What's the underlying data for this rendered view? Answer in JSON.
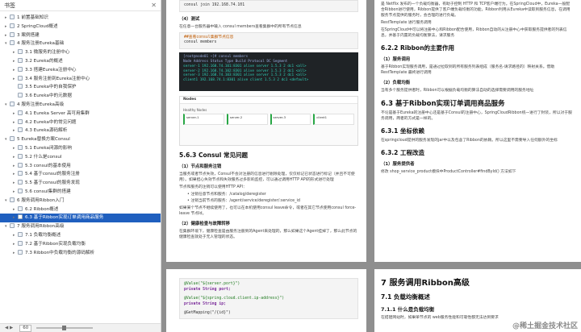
{
  "sidebar": {
    "title": "书签",
    "close_icon": "close-icon",
    "items": [
      {
        "label": "1 前置基础知识",
        "level": 1,
        "arrow": "▸"
      },
      {
        "label": "2 SpringCloud概述",
        "level": 1,
        "arrow": "▸"
      },
      {
        "label": "3 案例搭建",
        "level": 1,
        "arrow": "▸"
      },
      {
        "label": "4 服务注册Eureka基础",
        "level": 1,
        "arrow": "▾"
      },
      {
        "label": "3.1 微服务的注册中心",
        "level": 2,
        "arrow": "▸"
      },
      {
        "label": "3.2 Eureka的概述",
        "level": 2,
        "arrow": "▸"
      },
      {
        "label": "3.3 搭建Eureka注册中心",
        "level": 2,
        "arrow": "▸"
      },
      {
        "label": "3.4 服务注册到Eureka注册中心",
        "level": 2,
        "arrow": "▸"
      },
      {
        "label": "3.5 Eureka中的自我保护",
        "level": 2,
        "arrow": ""
      },
      {
        "label": "3.6 Eureka中的元数据",
        "level": 2,
        "arrow": ""
      },
      {
        "label": "4 服务注册Eureka高级",
        "level": 1,
        "arrow": "▾"
      },
      {
        "label": "4.1 Eureka Server 高可用集群",
        "level": 2,
        "arrow": "▸"
      },
      {
        "label": "4.2 Eureka中的常见问题",
        "level": 2,
        "arrow": "▸"
      },
      {
        "label": "4.3 Eureka源码解析",
        "level": 2,
        "arrow": "▸"
      },
      {
        "label": "5 Eureka替换方案Consul",
        "level": 1,
        "arrow": "▾"
      },
      {
        "label": "5.1 Eureka闭源的影响",
        "level": 2,
        "arrow": "▸"
      },
      {
        "label": "5.2 什么是consul",
        "level": 2,
        "arrow": "▸"
      },
      {
        "label": "5.3 consul的基本使用",
        "level": 2,
        "arrow": "▸"
      },
      {
        "label": "5.4 基于consul的服务注册",
        "level": 2,
        "arrow": "▸"
      },
      {
        "label": "5.5 基于consul的服务发现",
        "level": 2,
        "arrow": "▸"
      },
      {
        "label": "5.6 consul集群的搭建",
        "level": 2,
        "arrow": "▸"
      },
      {
        "label": "6 服务调用Ribbon入门",
        "level": 1,
        "arrow": "▾"
      },
      {
        "label": "6.2 Ribbon概述",
        "level": 2,
        "arrow": "▸"
      },
      {
        "label": "6.3 基于Ribbon实现订单调用商品服务",
        "level": 2,
        "arrow": "▸",
        "active": true
      },
      {
        "label": "7 服务调用Ribbon高级",
        "level": 1,
        "arrow": "▾"
      },
      {
        "label": "7.1 负载均衡概述",
        "level": 2,
        "arrow": "▸"
      },
      {
        "label": "7.2 基于Ribbon实现负载均衡",
        "level": 2,
        "arrow": "▸"
      },
      {
        "label": "7.3 Ribbon中负载均衡的源码解析",
        "level": 2,
        "arrow": "▸"
      }
    ],
    "footer": {
      "zoom": "60",
      "nav": "◀ ▶"
    }
  },
  "page1": {
    "code_top": "consul join 192.168.74.101",
    "h_test": "（4）测试",
    "p_test": "在任意一台服务器中输入 consul members查看集群中的所有节点信息",
    "code2_comment": "##查看consul集群节点信息",
    "code2_cmd": "consul members",
    "term_header": "[root@node01 ~]# consul members",
    "term_cols": "Node      Address              Status  Type    Build  Protocol  DC    Segment",
    "term_rows": [
      "server-1  192.168.74.101:8301  alive   server  1.5.3  2         dc1   <all>",
      "server-2  192.168.74.102:8301  alive   server  1.5.3  2         dc1   <all>",
      "server-3  192.168.74.103:8301  alive   server  1.5.3  2         dc1   <all>",
      "client1   192.168.74.1:8301    alive   client  1.5.3  2         dc1   <default>"
    ],
    "nodes_title": "Nodes",
    "nodes_sub": "Healthy Nodes",
    "node_cards": [
      "server-1",
      "server-2",
      "server-3",
      "client1"
    ],
    "h_consul": "5.6.3 Consul 常见问题",
    "h_q1": "（1）节点和服务注销",
    "p_q1": "当服务或者节点失效，Consul不会对注册的信息进行剔除处理，仅仅标记已状态进行标记（并且不可使用）。如果担心失效节点和失效服务过多影响监控，可以通过调用HTTP API的形式进行处理",
    "p_q1b": "节点和服务的注销可以使用HTTP API：",
    "bullets": [
      "注销任意节点和服务：/catalog/deregister",
      "注销当前节点的服务：/agent/service/deregister/:service_id"
    ],
    "p_q1c": "如果某个节点不继续使用了，也可以在本机使用consul leave命令，或者在其它节点使用consul force-leave 节点Id。",
    "h_q2": "（2）健康检查与故障转移",
    "p_q2": "在集群环境下，健康检查是由服务注册到的Agent来处理的，那么如果这个Agent挂掉了，那么此节点的健康检查就处于无人管理的状态。"
  },
  "page2": {
    "lines": [
      "@Value(\"${server.port}\")",
      "private String port;",
      "@Value(\"${spring.cloud.client.ip-address}\")",
      "private String ip;",
      "@GetMapping(\"/{id}\")"
    ]
  },
  "page3": {
    "p1": "是 Netflix 发布的一个负载均衡器，有助于控制 HTTP 和 TCP客户端行为。在SpringCloud中，Eureka一般配合Ribbon进行使用，Ribbon提供了客户端负载均衡的功能，Ribbon利用从Eureka中读取到服务信息，在调用服务节点提供的服务时，会合理的进行负载。",
    "p1b": "RestTemplate 进行服务调用",
    "p2": "在SpringCloud中可以将注册中心和Ribbon配合使用，Ribbon自动的从注册中心中获取服务提供者的列表信息，并基于内置的负载均衡算法，请求服务",
    "h622": "6.2.2 Ribbon的主要作用",
    "h_a": "（1）服务调用",
    "p_a": "基于Ribbon实现服务调用，是通过拉取到的所有服务列表组成（服务名-请求路径的）映射关系。借助RestTemplate 最终进行调用",
    "h_b": "（2）负载均衡",
    "p_b": "当有多个服务提供者时，Ribbon可以根据负载均衡的算法自动的选择需要调用的服务地址",
    "h63": "6.3 基于Ribbon实现订单调用商品服务",
    "p63": "不论是基于Eureka的注册中心还是基于Consul的注册中心，SpringCloudRibbon统一进行了封装，所以对于服务调用，两者的方式是一样的。",
    "h631": "6.3.1 坐标依赖",
    "p631": "在springcloud提供的服务发现的jar中以及包含了Ribbon的依赖。所以这里不需要导入任何额外的坐标",
    "h632": "6.3.2 工程改造",
    "h_c": "（1）服务提供者",
    "p_c": "修改 shop_service_product模块中ProductController#findById() 方法如下"
  },
  "page4": {
    "h7": "7 服务调用Ribbon高级",
    "h71": "7.1 负载均衡概述",
    "h711": "7.1.1 什么是负载均衡",
    "p": "在搭建网站时，如果单节点的 web服务性能和可靠性都无法达到要求",
    "watermark": "@稀土掘金技术社区"
  }
}
